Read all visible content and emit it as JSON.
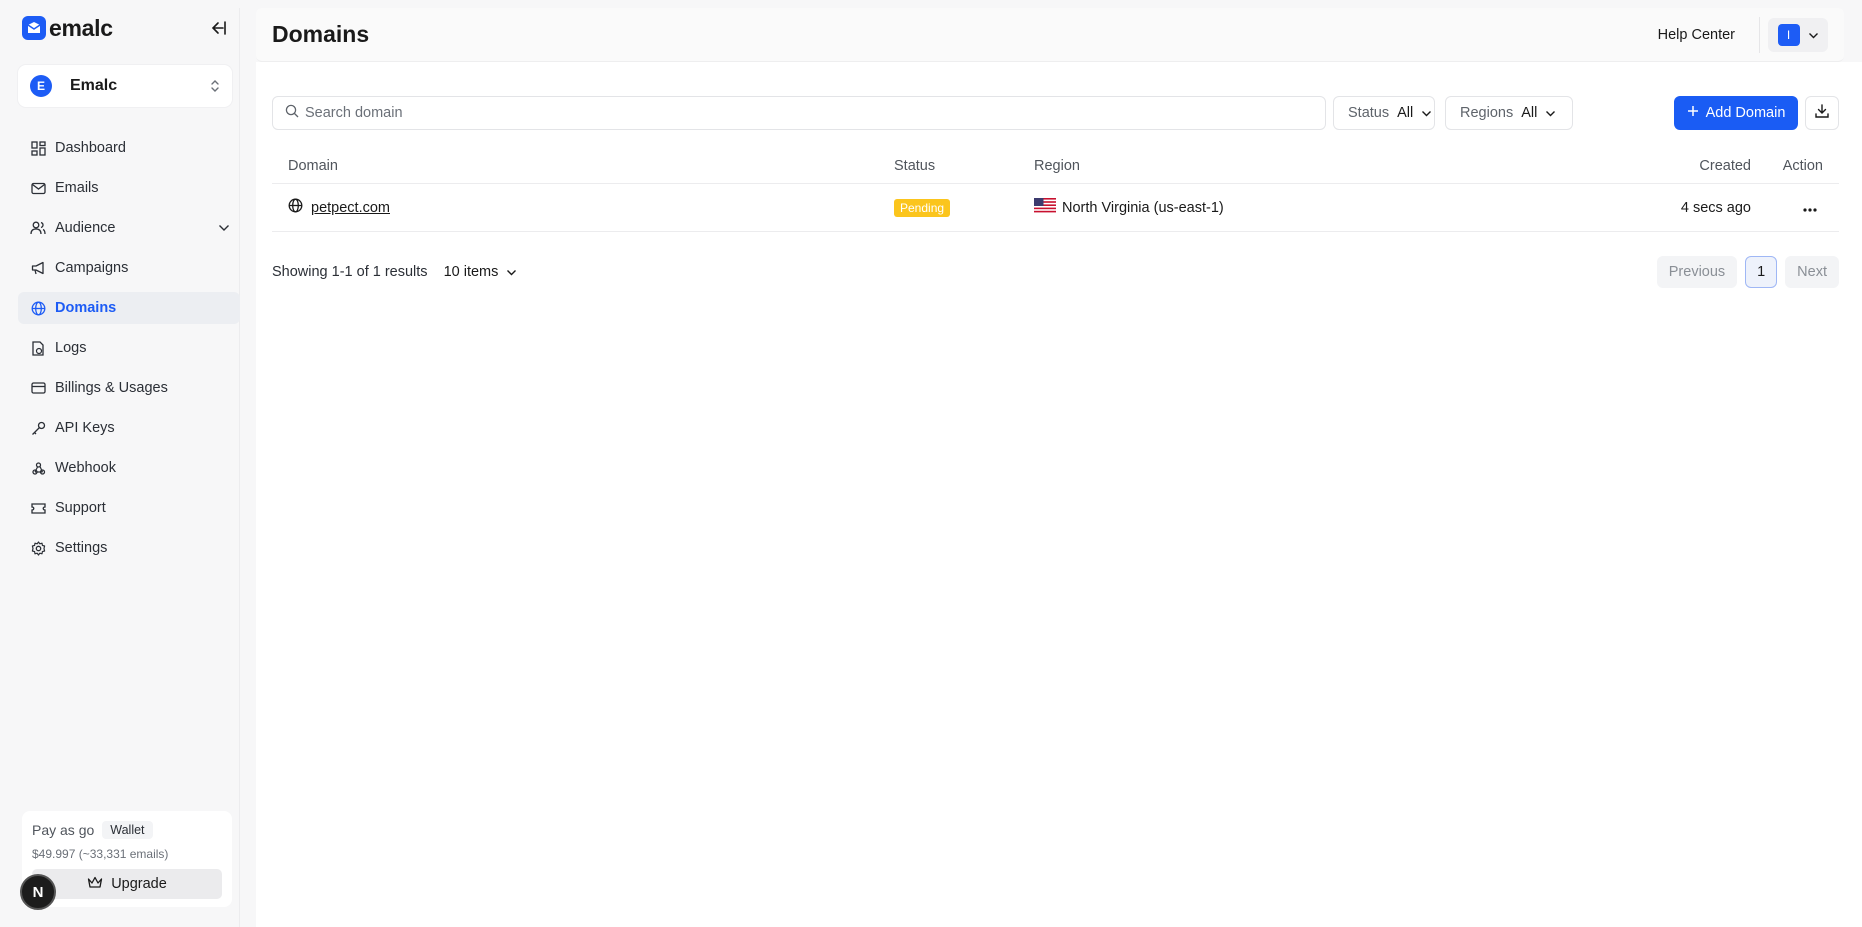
{
  "app": {
    "brand": "emalc"
  },
  "workspace": {
    "initial": "E",
    "name": "Emalc"
  },
  "sidebar": {
    "items": [
      {
        "label": "Dashboard",
        "icon": "dashboard-icon"
      },
      {
        "label": "Emails",
        "icon": "mail-icon"
      },
      {
        "label": "Audience",
        "icon": "users-icon"
      },
      {
        "label": "Campaigns",
        "icon": "megaphone-icon"
      },
      {
        "label": "Domains",
        "icon": "globe-icon"
      },
      {
        "label": "Logs",
        "icon": "logs-icon"
      },
      {
        "label": "Billings & Usages",
        "icon": "card-icon"
      },
      {
        "label": "API Keys",
        "icon": "key-icon"
      },
      {
        "label": "Webhook",
        "icon": "webhook-icon"
      },
      {
        "label": "Support",
        "icon": "ticket-icon"
      },
      {
        "label": "Settings",
        "icon": "gear-icon"
      }
    ],
    "active": "Domains"
  },
  "plan": {
    "label": "Pay as go",
    "wallet": "Wallet",
    "balance": "$49.997 (~33,331 emails)",
    "upgrade": "Upgrade",
    "badge": "N"
  },
  "header": {
    "title": "Domains",
    "help": "Help Center",
    "user_initial": "I"
  },
  "toolbar": {
    "search_placeholder": "Search domain",
    "status_label": "Status",
    "status_value": "All",
    "regions_label": "Regions",
    "regions_value": "All",
    "add_label": "Add Domain"
  },
  "table": {
    "columns": {
      "domain": "Domain",
      "status": "Status",
      "region": "Region",
      "created": "Created",
      "action": "Action"
    },
    "rows": [
      {
        "domain": "petpect.com",
        "status": "Pending",
        "region": "North Virginia (us-east-1)",
        "created": "4 secs ago"
      }
    ]
  },
  "pagination": {
    "summary": "Showing 1-1 of 1 results",
    "per_page": "10 items",
    "previous": "Previous",
    "current": "1",
    "next": "Next"
  },
  "colors": {
    "accent": "#1a5cf4",
    "pending": "#fbc51d"
  }
}
